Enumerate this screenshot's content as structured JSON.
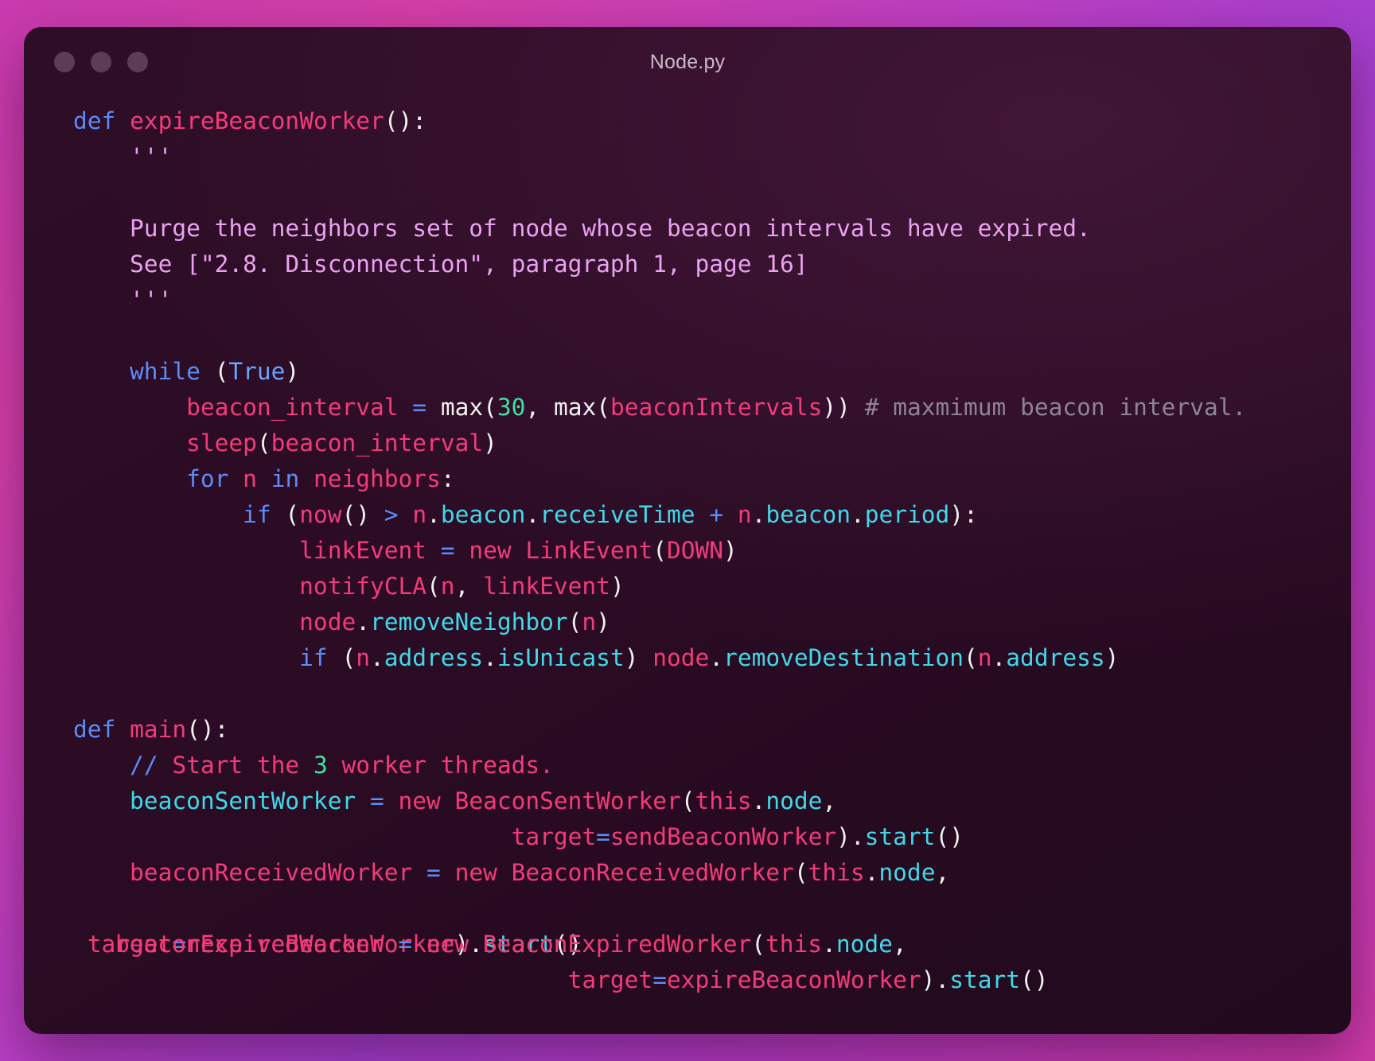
{
  "window": {
    "title": "Node.py",
    "traffic_lights": [
      "close-dot",
      "minimize-dot",
      "zoom-dot"
    ],
    "accent_background": "#c93bb0",
    "window_background": "#2e0d26"
  },
  "theme": {
    "keyword": "#5b8cf7",
    "identifier_pink": "#f43b79",
    "attribute_cyan": "#3fd9e8",
    "number_green": "#3fe0a0",
    "docstring_violet": "#e9a2f0",
    "comment_grey": "#8d8591",
    "punctuation_white": "#f2f2f2"
  },
  "code": {
    "language": "python",
    "filename": "Node.py",
    "lines": [
      {
        "id": "l01",
        "segments": [
          {
            "t": "def",
            "c": "kw"
          },
          {
            "t": " ",
            "c": "pun"
          },
          {
            "t": "expireBeaconWorker",
            "c": "fn"
          },
          {
            "t": "():",
            "c": "pun"
          }
        ]
      },
      {
        "id": "l02",
        "segments": [
          {
            "t": "    '''",
            "c": "doc"
          }
        ]
      },
      {
        "id": "l03",
        "segments": [
          {
            "t": "",
            "c": "pun"
          }
        ]
      },
      {
        "id": "l04",
        "segments": [
          {
            "t": "    Purge the neighbors set of node whose beacon intervals have expired.",
            "c": "doc"
          }
        ]
      },
      {
        "id": "l05",
        "segments": [
          {
            "t": "    See [\"2.8. Disconnection\", paragraph 1, page 16]",
            "c": "doc"
          }
        ]
      },
      {
        "id": "l06",
        "segments": [
          {
            "t": "    '''",
            "c": "doc"
          }
        ]
      },
      {
        "id": "l07",
        "segments": [
          {
            "t": "",
            "c": "pun"
          }
        ]
      },
      {
        "id": "l08",
        "segments": [
          {
            "t": "    ",
            "c": "pun"
          },
          {
            "t": "while",
            "c": "kw"
          },
          {
            "t": " (",
            "c": "pun"
          },
          {
            "t": "True",
            "c": "boolv"
          },
          {
            "t": ")",
            "c": "pun"
          }
        ]
      },
      {
        "id": "l09",
        "segments": [
          {
            "t": "        ",
            "c": "pun"
          },
          {
            "t": "beacon_interval",
            "c": "pnk"
          },
          {
            "t": " ",
            "c": "pun"
          },
          {
            "t": "=",
            "c": "op"
          },
          {
            "t": " ",
            "c": "pun"
          },
          {
            "t": "max",
            "c": "pun"
          },
          {
            "t": "(",
            "c": "pun"
          },
          {
            "t": "30",
            "c": "num"
          },
          {
            "t": ", ",
            "c": "pun"
          },
          {
            "t": "max",
            "c": "pun"
          },
          {
            "t": "(",
            "c": "pun"
          },
          {
            "t": "beaconIntervals",
            "c": "pnk"
          },
          {
            "t": "))",
            "c": "pun"
          },
          {
            "t": " # maxmimum beacon interval.",
            "c": "cmt"
          }
        ]
      },
      {
        "id": "l10",
        "segments": [
          {
            "t": "        ",
            "c": "pun"
          },
          {
            "t": "sleep",
            "c": "pnk"
          },
          {
            "t": "(",
            "c": "pun"
          },
          {
            "t": "beacon_interval",
            "c": "pnk"
          },
          {
            "t": ")",
            "c": "pun"
          }
        ]
      },
      {
        "id": "l11",
        "segments": [
          {
            "t": "        ",
            "c": "pun"
          },
          {
            "t": "for",
            "c": "kw"
          },
          {
            "t": " ",
            "c": "pun"
          },
          {
            "t": "n",
            "c": "pnk"
          },
          {
            "t": " ",
            "c": "pun"
          },
          {
            "t": "in",
            "c": "kw"
          },
          {
            "t": " ",
            "c": "pun"
          },
          {
            "t": "neighbors",
            "c": "pnk"
          },
          {
            "t": ":",
            "c": "pun"
          }
        ]
      },
      {
        "id": "l12",
        "segments": [
          {
            "t": "            ",
            "c": "pun"
          },
          {
            "t": "if",
            "c": "kw"
          },
          {
            "t": " (",
            "c": "pun"
          },
          {
            "t": "now",
            "c": "pnk"
          },
          {
            "t": "()",
            "c": "pun"
          },
          {
            "t": " ",
            "c": "pun"
          },
          {
            "t": ">",
            "c": "op"
          },
          {
            "t": " ",
            "c": "pun"
          },
          {
            "t": "n",
            "c": "pnk"
          },
          {
            "t": ".",
            "c": "pun"
          },
          {
            "t": "beacon",
            "c": "cy"
          },
          {
            "t": ".",
            "c": "pun"
          },
          {
            "t": "receiveTime",
            "c": "cy"
          },
          {
            "t": " ",
            "c": "pun"
          },
          {
            "t": "+",
            "c": "op"
          },
          {
            "t": " ",
            "c": "pun"
          },
          {
            "t": "n",
            "c": "pnk"
          },
          {
            "t": ".",
            "c": "pun"
          },
          {
            "t": "beacon",
            "c": "cy"
          },
          {
            "t": ".",
            "c": "pun"
          },
          {
            "t": "period",
            "c": "cy"
          },
          {
            "t": "):",
            "c": "pun"
          }
        ]
      },
      {
        "id": "l13",
        "segments": [
          {
            "t": "                ",
            "c": "pun"
          },
          {
            "t": "linkEvent",
            "c": "pnk"
          },
          {
            "t": " ",
            "c": "pun"
          },
          {
            "t": "=",
            "c": "op"
          },
          {
            "t": " ",
            "c": "pun"
          },
          {
            "t": "new LinkEvent",
            "c": "pnk"
          },
          {
            "t": "(",
            "c": "pun"
          },
          {
            "t": "DOWN",
            "c": "pnk"
          },
          {
            "t": ")",
            "c": "pun"
          }
        ]
      },
      {
        "id": "l14",
        "segments": [
          {
            "t": "                ",
            "c": "pun"
          },
          {
            "t": "notifyCLA",
            "c": "pnk"
          },
          {
            "t": "(",
            "c": "pun"
          },
          {
            "t": "n",
            "c": "pnk"
          },
          {
            "t": ", ",
            "c": "pun"
          },
          {
            "t": "linkEvent",
            "c": "pnk"
          },
          {
            "t": ")",
            "c": "pun"
          }
        ]
      },
      {
        "id": "l15",
        "segments": [
          {
            "t": "                ",
            "c": "pun"
          },
          {
            "t": "node",
            "c": "pnk"
          },
          {
            "t": ".",
            "c": "pun"
          },
          {
            "t": "removeNeighbor",
            "c": "cy"
          },
          {
            "t": "(",
            "c": "pun"
          },
          {
            "t": "n",
            "c": "pnk"
          },
          {
            "t": ")",
            "c": "pun"
          }
        ]
      },
      {
        "id": "l16",
        "segments": [
          {
            "t": "                ",
            "c": "pun"
          },
          {
            "t": "if",
            "c": "kw"
          },
          {
            "t": " (",
            "c": "pun"
          },
          {
            "t": "n",
            "c": "pnk"
          },
          {
            "t": ".",
            "c": "pun"
          },
          {
            "t": "address",
            "c": "cy"
          },
          {
            "t": ".",
            "c": "pun"
          },
          {
            "t": "isUnicast",
            "c": "cy"
          },
          {
            "t": ") ",
            "c": "pun"
          },
          {
            "t": "node",
            "c": "pnk"
          },
          {
            "t": ".",
            "c": "pun"
          },
          {
            "t": "removeDestination",
            "c": "cy"
          },
          {
            "t": "(",
            "c": "pun"
          },
          {
            "t": "n",
            "c": "pnk"
          },
          {
            "t": ".",
            "c": "pun"
          },
          {
            "t": "address",
            "c": "cy"
          },
          {
            "t": ")",
            "c": "pun"
          }
        ]
      },
      {
        "id": "l17",
        "segments": [
          {
            "t": "",
            "c": "pun"
          }
        ]
      },
      {
        "id": "l18",
        "segments": [
          {
            "t": "def",
            "c": "kw"
          },
          {
            "t": " ",
            "c": "pun"
          },
          {
            "t": "main",
            "c": "fn"
          },
          {
            "t": "():",
            "c": "pun"
          }
        ]
      },
      {
        "id": "l19",
        "segments": [
          {
            "t": "    ",
            "c": "pun"
          },
          {
            "t": "//",
            "c": "kw"
          },
          {
            "t": " ",
            "c": "pun"
          },
          {
            "t": "Start the ",
            "c": "pnk"
          },
          {
            "t": "3",
            "c": "num"
          },
          {
            "t": " worker threads.",
            "c": "pnk"
          }
        ]
      },
      {
        "id": "l20",
        "segments": [
          {
            "t": "    ",
            "c": "pun"
          },
          {
            "t": "beaconSentWorker",
            "c": "cy"
          },
          {
            "t": " ",
            "c": "pun"
          },
          {
            "t": "=",
            "c": "op"
          },
          {
            "t": " ",
            "c": "pun"
          },
          {
            "t": "new BeaconSentWorker",
            "c": "pnk"
          },
          {
            "t": "(",
            "c": "pun"
          },
          {
            "t": "this",
            "c": "pnk"
          },
          {
            "t": ".",
            "c": "pun"
          },
          {
            "t": "node",
            "c": "cy"
          },
          {
            "t": ",",
            "c": "pun"
          }
        ]
      },
      {
        "id": "l21",
        "segments": [
          {
            "t": "                               ",
            "c": "pun"
          },
          {
            "t": "target",
            "c": "pnk"
          },
          {
            "t": "=",
            "c": "op"
          },
          {
            "t": "sendBeaconWorker",
            "c": "pnk"
          },
          {
            "t": ").",
            "c": "pun"
          },
          {
            "t": "start",
            "c": "cy"
          },
          {
            "t": "()",
            "c": "pun"
          }
        ]
      },
      {
        "id": "l22",
        "segments": [
          {
            "t": "    ",
            "c": "pun"
          },
          {
            "t": "beaconReceivedWorker",
            "c": "pnk"
          },
          {
            "t": " ",
            "c": "pun"
          },
          {
            "t": "=",
            "c": "op"
          },
          {
            "t": " ",
            "c": "pun"
          },
          {
            "t": "new BeaconReceivedWorker",
            "c": "pnk"
          },
          {
            "t": "(",
            "c": "pun"
          },
          {
            "t": "this",
            "c": "pnk"
          },
          {
            "t": ".",
            "c": "pun"
          },
          {
            "t": "node",
            "c": "cy"
          },
          {
            "t": ",",
            "c": "pun"
          }
        ]
      },
      {
        "id": "l23",
        "segments": [
          {
            "t": "",
            "c": "pun"
          }
        ]
      }
    ],
    "overlap_line": {
      "note": "two code lines rendered on top of each other",
      "layer_a": [
        {
          "t": " target",
          "c": "pnk"
        },
        {
          "t": "=",
          "c": "op"
        },
        {
          "t": "receiveBeaconWorker",
          "c": "pnk"
        },
        {
          "t": ").",
          "c": "pun"
        },
        {
          "t": "start",
          "c": "cy"
        },
        {
          "t": "()",
          "c": "pun"
        }
      ],
      "layer_b": [
        {
          "t": "beaconExpiredWorker",
          "c": "pnk"
        },
        {
          "t": " ",
          "c": "pun"
        },
        {
          "t": "=",
          "c": "op"
        },
        {
          "t": " ",
          "c": "pun"
        },
        {
          "t": "new BeaconExpiredWorker",
          "c": "pnk"
        },
        {
          "t": "(",
          "c": "pun"
        },
        {
          "t": "this",
          "c": "pnk"
        },
        {
          "t": ".",
          "c": "pun"
        },
        {
          "t": "node",
          "c": "cy"
        },
        {
          "t": ",",
          "c": "pun"
        }
      ]
    },
    "final_line": [
      {
        "t": "                                   ",
        "c": "pun"
      },
      {
        "t": "target",
        "c": "pnk"
      },
      {
        "t": "=",
        "c": "op"
      },
      {
        "t": "expireBeaconWorker",
        "c": "pnk"
      },
      {
        "t": ").",
        "c": "pun"
      },
      {
        "t": "start",
        "c": "cy"
      },
      {
        "t": "()",
        "c": "pun"
      }
    ]
  }
}
